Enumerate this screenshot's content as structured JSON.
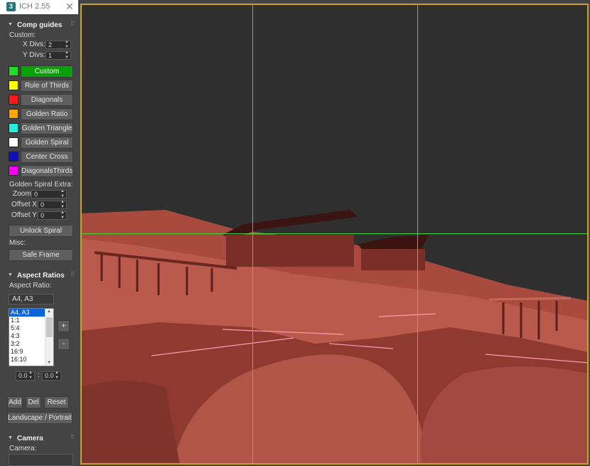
{
  "window": {
    "title": "ICH 2.55",
    "app_icon": "3",
    "close_glyph": "✕"
  },
  "comp_guides": {
    "header": "Comp guides",
    "custom_label": "Custom:",
    "x_divs_label": "X Divs:",
    "x_divs_value": "2",
    "y_divs_label": "Y Divs:",
    "y_divs_value": "1",
    "guides": [
      {
        "label": "Custom",
        "color": "#22dd22",
        "active": true
      },
      {
        "label": "Rule of Thirds",
        "color": "#ffff00"
      },
      {
        "label": "Diagonals",
        "color": "#ff1a1a"
      },
      {
        "label": "Golden Ratio",
        "color": "#ffa500"
      },
      {
        "label": "Golden Triangle",
        "color": "#22eedd"
      },
      {
        "label": "Golden Spiral",
        "color": "#ffffff"
      },
      {
        "label": "Center Cross",
        "color": "#1010c0"
      },
      {
        "label": "DiagonalsThirds",
        "color": "#ff00ff"
      }
    ],
    "spiral_extra_label": "Golden Spiral Extra:",
    "zoom_label": "Zoom",
    "zoom_value": "0",
    "offset_x_label": "Offset X",
    "offset_x_value": "0",
    "offset_y_label": "Offset Y",
    "offset_y_value": "0",
    "unlock_spiral": "Unlock Spiral",
    "misc_label": "Misc:",
    "safe_frame": "Safe Frame"
  },
  "aspect_ratios": {
    "header": "Aspect Ratios",
    "label": "Aspect Ratio:",
    "current": "A4, A3",
    "list": [
      "A4, A3",
      "1:1",
      "5:4",
      "4:3",
      "3:2",
      "16:9",
      "16:10"
    ],
    "plus": "+",
    "minus": "-",
    "ratio_left": "0.0",
    "ratio_sep": ":",
    "ratio_right": "0.0",
    "add": "Add",
    "del": "Del",
    "reset": "Reset",
    "landscape_portrait": "Landscape / Portrait"
  },
  "camera": {
    "header": "Camera",
    "label": "Camera:"
  },
  "viewport": {
    "guide_color": "#44d63a",
    "frame_color": "#c9a227",
    "v_guides": [
      0.338,
      0.663
    ],
    "h_guides": [
      0.498
    ]
  }
}
